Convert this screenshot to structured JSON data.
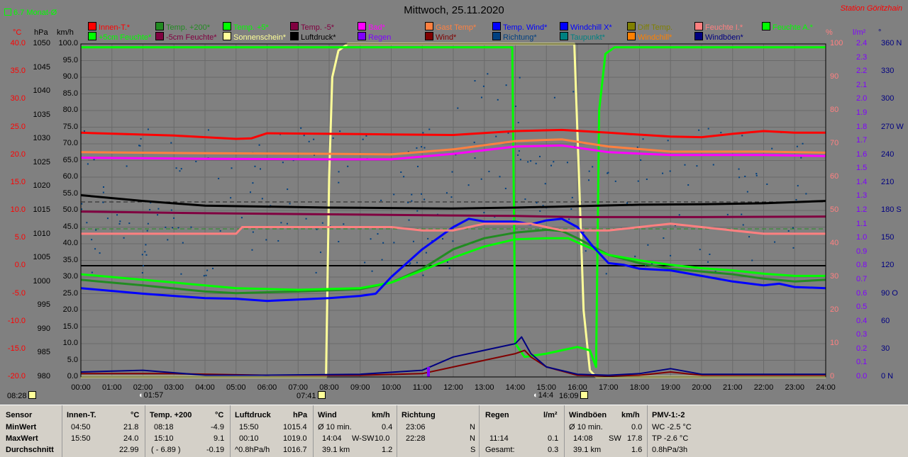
{
  "header": {
    "monat_label": "6.7 Monat-Ø",
    "title": "Mittwoch, 25.11.2020",
    "station": "Station Göritzhain"
  },
  "legend_row1": [
    {
      "label": "Innen-T.*",
      "color": "#ff0000"
    },
    {
      "label": "Temp. +200*",
      "color": "#228b22"
    },
    {
      "label": "Temp. +5*",
      "color": "#00ff00"
    },
    {
      "label": "Temp. -5*",
      "color": "#800040"
    },
    {
      "label": "Bad*",
      "color": "#ff00ff"
    },
    {
      "label": "Gast Temp*",
      "color": "#ff8040"
    },
    {
      "label": "Temp. Wind*",
      "color": "#0000ff"
    },
    {
      "label": "Windchill X*",
      "color": "#0000ff"
    },
    {
      "label": "Diff Temp.",
      "color": "#808000"
    },
    {
      "label": "Feuchte I.*",
      "color": "#ff8080"
    },
    {
      "label": "Feuchte A.*",
      "color": "#00ff00"
    }
  ],
  "legend_row2": [
    {
      "label": "+5cm Feuchte*",
      "color": "#00ff00"
    },
    {
      "label": "-5cm Feuchte*",
      "color": "#800040"
    },
    {
      "label": "Sonnenschein*",
      "color": "#ffff99"
    },
    {
      "label": "Luftdruck*",
      "color": "#000000"
    },
    {
      "label": "Regen",
      "color": "#8000ff"
    },
    {
      "label": "Wind*",
      "color": "#800000"
    },
    {
      "label": "Richtung*",
      "color": "#004080"
    },
    {
      "label": "Taupunkt*",
      "color": "#008080"
    },
    {
      "label": "Windchill*",
      "color": "#ff8000"
    },
    {
      "label": "Windböen*",
      "color": "#000080"
    }
  ],
  "axes": {
    "temp_unit": "°C",
    "hpa_unit": "hPa",
    "kmh_unit": "km/h",
    "pct_unit": "%",
    "lm2_unit": "l/m²",
    "deg_unit": "°",
    "temp_ticks": [
      "40.0",
      "35.0",
      "30.0",
      "25.0",
      "20.0",
      "15.0",
      "10.0",
      "5.0",
      "0.0",
      "-5.0",
      "-10.0",
      "-15.0",
      "-20.0"
    ],
    "hpa_ticks": [
      "1050",
      "1045",
      "1040",
      "1035",
      "1030",
      "1025",
      "1020",
      "1015",
      "1010",
      "1005",
      "1000",
      "995",
      "990",
      "985",
      "980"
    ],
    "kmh_ticks": [
      "100.0",
      "95.0",
      "90.0",
      "85.0",
      "80.0",
      "75.0",
      "70.0",
      "65.0",
      "60.0",
      "55.0",
      "50.0",
      "45.0",
      "40.0",
      "35.0",
      "30.0",
      "25.0",
      "20.0",
      "15.0",
      "10.0",
      "5.0",
      "0.0"
    ],
    "pct_ticks": [
      "100",
      "90",
      "80",
      "70",
      "60",
      "50",
      "40",
      "30",
      "20",
      "10",
      "0"
    ],
    "lm2_ticks": [
      "2.4",
      "2.3",
      "2.2",
      "2.1",
      "2.0",
      "1.9",
      "1.8",
      "1.7",
      "1.6",
      "1.5",
      "1.4",
      "1.3",
      "1.2",
      "1.1",
      "1.0",
      "0.9",
      "0.8",
      "0.7",
      "0.6",
      "0.5",
      "0.4",
      "0.3",
      "0.2",
      "0.1",
      "0.0"
    ],
    "deg_ticks": [
      "360 N",
      "330",
      "300",
      "270 W",
      "240",
      "210",
      "180 S",
      "150",
      "120",
      "90 O",
      "60",
      "30",
      "0 N"
    ],
    "x_ticks": [
      "00:00",
      "01:00",
      "02:00",
      "03:00",
      "04:00",
      "05:00",
      "06:00",
      "07:00",
      "08:00",
      "09:00",
      "10:00",
      "11:00",
      "12:00",
      "13:00",
      "14:00",
      "15:00",
      "16:00",
      "17:00",
      "18:00",
      "19:00",
      "20:00",
      "21:00",
      "22:00",
      "23:00",
      "24:00"
    ]
  },
  "events": {
    "sunrise_prev": "08:28",
    "moon_set": "01:57",
    "sunrise": "07:41",
    "moon_rise": "14:4",
    "sunset": "16:09"
  },
  "chart_data": {
    "type": "line",
    "title": "Mittwoch, 25.11.2020",
    "x_unit": "hour",
    "x_range": [
      0,
      24
    ],
    "series": [
      {
        "name": "Sonnenschein*",
        "axis": "pct",
        "color": "#ffff99",
        "points": [
          [
            0,
            0
          ],
          [
            7.9,
            0
          ],
          [
            8.0,
            60
          ],
          [
            8.1,
            90
          ],
          [
            8.3,
            98
          ],
          [
            8.6,
            100
          ],
          [
            15.9,
            100
          ],
          [
            16.05,
            60
          ],
          [
            16.2,
            20
          ],
          [
            16.4,
            2
          ],
          [
            16.6,
            0
          ],
          [
            24,
            0
          ]
        ]
      },
      {
        "name": "Feuchte A.*",
        "axis": "pct",
        "color": "#00ff00",
        "points": [
          [
            0,
            99
          ],
          [
            13.9,
            99
          ],
          [
            14.0,
            10
          ],
          [
            14.3,
            6
          ],
          [
            15.0,
            7
          ],
          [
            15.5,
            8
          ],
          [
            16.0,
            9
          ],
          [
            16.4,
            8
          ],
          [
            16.6,
            3
          ],
          [
            16.7,
            80
          ],
          [
            16.9,
            97
          ],
          [
            17.2,
            99
          ],
          [
            24,
            99
          ]
        ]
      },
      {
        "name": "Innen-T.*",
        "axis": "temp",
        "color": "#ff0000",
        "points": [
          [
            0,
            24.0
          ],
          [
            3,
            23.5
          ],
          [
            5,
            22.9
          ],
          [
            5.5,
            23.0
          ],
          [
            6,
            23.9
          ],
          [
            8,
            23.8
          ],
          [
            10,
            23.7
          ],
          [
            12,
            23.6
          ],
          [
            14,
            24.3
          ],
          [
            15.5,
            24.5
          ],
          [
            17,
            24.0
          ],
          [
            19,
            23.3
          ],
          [
            20,
            23.2
          ],
          [
            21,
            23.8
          ],
          [
            22,
            24.3
          ],
          [
            23,
            24.0
          ],
          [
            24,
            24.0
          ]
        ]
      },
      {
        "name": "Luftdruck*",
        "axis": "hpa",
        "color": "#000000",
        "points": [
          [
            0,
            1018.2
          ],
          [
            2,
            1017.0
          ],
          [
            4,
            1016.0
          ],
          [
            6,
            1015.8
          ],
          [
            8,
            1015.6
          ],
          [
            10,
            1015.5
          ],
          [
            12,
            1015.4
          ],
          [
            14,
            1015.6
          ],
          [
            16,
            1015.9
          ],
          [
            18,
            1016.2
          ],
          [
            20,
            1016.3
          ],
          [
            22,
            1016.5
          ],
          [
            24,
            1017.0
          ]
        ]
      },
      {
        "name": "Temp. +200*",
        "axis": "temp",
        "color": "#228b22",
        "points": [
          [
            0,
            -2.5
          ],
          [
            2,
            -3.5
          ],
          [
            4,
            -4.6
          ],
          [
            5,
            -4.9
          ],
          [
            7,
            -4.6
          ],
          [
            9,
            -4.2
          ],
          [
            10,
            -3.0
          ],
          [
            11,
            -0.5
          ],
          [
            12,
            3.0
          ],
          [
            13,
            5.0
          ],
          [
            14,
            6.0
          ],
          [
            15,
            6.5
          ],
          [
            15.5,
            6.3
          ],
          [
            16,
            5.0
          ],
          [
            17,
            2.0
          ],
          [
            18,
            0.5
          ],
          [
            19,
            -0.5
          ],
          [
            20,
            -1.0
          ],
          [
            21,
            -1.5
          ],
          [
            22,
            -2.3
          ],
          [
            23,
            -2.8
          ],
          [
            24,
            -2.5
          ]
        ]
      },
      {
        "name": "Temp. +5*",
        "axis": "temp",
        "color": "#00ff00",
        "points": [
          [
            0,
            -1.5
          ],
          [
            3,
            -3.0
          ],
          [
            5,
            -4.0
          ],
          [
            7,
            -4.3
          ],
          [
            9,
            -4.0
          ],
          [
            10,
            -3.0
          ],
          [
            11,
            -0.8
          ],
          [
            12,
            1.5
          ],
          [
            13,
            3.5
          ],
          [
            14,
            4.8
          ],
          [
            15,
            5.0
          ],
          [
            15.7,
            5.0
          ],
          [
            16.3,
            3.5
          ],
          [
            17,
            2.0
          ],
          [
            18,
            1.0
          ],
          [
            19,
            0.2
          ],
          [
            20,
            -0.4
          ],
          [
            21,
            -0.8
          ],
          [
            22,
            -1.4
          ],
          [
            23,
            -1.8
          ],
          [
            24,
            -1.8
          ]
        ]
      },
      {
        "name": "Temp. Wind*",
        "axis": "temp",
        "color": "#0000ff",
        "points": [
          [
            0,
            -4.0
          ],
          [
            2,
            -5.0
          ],
          [
            4,
            -5.8
          ],
          [
            5,
            -5.9
          ],
          [
            6,
            -6.3
          ],
          [
            8,
            -5.8
          ],
          [
            9,
            -5.4
          ],
          [
            9.5,
            -5.0
          ],
          [
            10,
            -2.0
          ],
          [
            11,
            3.0
          ],
          [
            12,
            7.0
          ],
          [
            12.5,
            8.5
          ],
          [
            13,
            8.0
          ],
          [
            14,
            8.0
          ],
          [
            14.5,
            7.5
          ],
          [
            15,
            8.2
          ],
          [
            15.5,
            8.5
          ],
          [
            16,
            7.0
          ],
          [
            16.5,
            3.5
          ],
          [
            17,
            0.5
          ],
          [
            17.5,
            0.2
          ],
          [
            18,
            -0.5
          ],
          [
            19,
            -0.8
          ],
          [
            20,
            -1.8
          ],
          [
            21,
            -2.8
          ],
          [
            22,
            -3.5
          ],
          [
            22.5,
            -3.2
          ],
          [
            23,
            -3.8
          ],
          [
            24,
            -4.0
          ]
        ]
      },
      {
        "name": "Temp. -5*",
        "axis": "temp",
        "color": "#800040",
        "points": [
          [
            0,
            9.8
          ],
          [
            4,
            9.5
          ],
          [
            8,
            9.3
          ],
          [
            12,
            9.1
          ],
          [
            14,
            9.0
          ],
          [
            16,
            8.8
          ],
          [
            20,
            8.8
          ],
          [
            24,
            8.9
          ]
        ]
      },
      {
        "name": "Gast Temp*",
        "axis": "temp",
        "color": "#ff8040",
        "points": [
          [
            0,
            20.5
          ],
          [
            4,
            20.3
          ],
          [
            8,
            20.2
          ],
          [
            10,
            20.1
          ],
          [
            12,
            21.0
          ],
          [
            14,
            22.5
          ],
          [
            15.5,
            22.8
          ],
          [
            17,
            21.5
          ],
          [
            19,
            20.6
          ],
          [
            22,
            20.6
          ],
          [
            24,
            20.4
          ]
        ]
      },
      {
        "name": "Bad*",
        "axis": "temp",
        "color": "#ff00ff",
        "points": [
          [
            0,
            19.5
          ],
          [
            4,
            19.3
          ],
          [
            8,
            19.2
          ],
          [
            10,
            19.2
          ],
          [
            12,
            20.2
          ],
          [
            14,
            21.5
          ],
          [
            15.5,
            21.7
          ],
          [
            17,
            20.5
          ],
          [
            19,
            20.0
          ],
          [
            22,
            20.0
          ],
          [
            24,
            19.8
          ]
        ]
      },
      {
        "name": "Feuchte I.*",
        "axis": "pct",
        "color": "#ff8080",
        "points": [
          [
            0,
            43
          ],
          [
            5,
            43
          ],
          [
            5.2,
            45
          ],
          [
            10,
            45
          ],
          [
            11,
            44
          ],
          [
            12,
            44
          ],
          [
            13,
            46
          ],
          [
            14.5,
            46
          ],
          [
            15.5,
            44
          ],
          [
            17,
            44
          ],
          [
            18,
            45
          ],
          [
            19,
            46
          ],
          [
            20,
            45
          ],
          [
            21,
            44
          ],
          [
            22,
            43
          ],
          [
            24,
            43
          ]
        ]
      },
      {
        "name": "Wind*",
        "axis": "kmh",
        "color": "#800000",
        "points": [
          [
            0,
            1
          ],
          [
            3,
            1
          ],
          [
            6,
            0.5
          ],
          [
            9,
            0.5
          ],
          [
            11,
            1
          ],
          [
            12,
            3
          ],
          [
            13,
            5
          ],
          [
            14,
            7
          ],
          [
            14.3,
            8
          ],
          [
            14.5,
            6
          ],
          [
            15,
            3
          ],
          [
            16,
            0.5
          ],
          [
            17,
            0.3
          ],
          [
            18,
            0.5
          ],
          [
            19,
            1.5
          ],
          [
            20,
            0.5
          ],
          [
            24,
            0.5
          ]
        ]
      },
      {
        "name": "Windböen*",
        "axis": "kmh",
        "color": "#000080",
        "points": [
          [
            0,
            1.5
          ],
          [
            2,
            2
          ],
          [
            4,
            0.5
          ],
          [
            6,
            0.5
          ],
          [
            9,
            0.8
          ],
          [
            11,
            2
          ],
          [
            12,
            6
          ],
          [
            13,
            8
          ],
          [
            14,
            10
          ],
          [
            14.2,
            12
          ],
          [
            14.5,
            7
          ],
          [
            15,
            3
          ],
          [
            16,
            0.8
          ],
          [
            17,
            0.5
          ],
          [
            18,
            1
          ],
          [
            19,
            2.5
          ],
          [
            20,
            0.8
          ],
          [
            24,
            0.8
          ]
        ]
      }
    ]
  },
  "stats": {
    "headers": {
      "sensor": "Sensor",
      "innen": "Innen-T.",
      "innen_u": "°C",
      "temp200": "Temp. +200",
      "temp200_u": "°C",
      "luftdruck": "Luftdruck",
      "luftdruck_u": "hPa",
      "wind": "Wind",
      "wind_u": "km/h",
      "richtung": "Richtung",
      "regen": "Regen",
      "regen_u": "l/m²",
      "windboeen": "Windböen",
      "windboeen_u": "km/h",
      "pmv": "PMV-1:-2"
    },
    "rowlabels": {
      "min": "MinWert",
      "max": "MaxWert",
      "avg": "Durchschnitt"
    },
    "innen": {
      "min_t": "04:50",
      "min_v": "21.8",
      "max_t": "15:50",
      "max_v": "24.0",
      "avg_v": "22.99"
    },
    "temp200": {
      "min_t": "08:18",
      "min_v": "-4.9",
      "max_t": "15:10",
      "max_v": "9.1",
      "avg_t": "( - 6.89 )",
      "avg_v": "-0.19"
    },
    "luftdruck": {
      "min_t": "15:50",
      "min_v": "1015.4",
      "max_t": "00:10",
      "max_v": "1019.0",
      "avg_t": "^0.8hPa/h",
      "avg_v": "1016.7"
    },
    "wind": {
      "min_t": "Ø 10 min.",
      "min_v": "0.4",
      "max_t": "14:04",
      "max_d": "W-SW",
      "max_v": "10.0",
      "avg_t": "39.1 km",
      "avg_v": "1.2"
    },
    "richtung": {
      "min_t": "23:06",
      "min_v": "N",
      "max_t": "22:28",
      "max_v": "N",
      "avg_v": "S"
    },
    "regen": {
      "max_t": "11:14",
      "max_v": "0.1",
      "avg_t": "Gesamt:",
      "avg_v": "0.3"
    },
    "windboeen": {
      "min_t": "Ø 10 min.",
      "min_v": "0.0",
      "max_t": "14:08",
      "max_d": "SW",
      "max_v": "17.8",
      "avg_t": "39.1 km",
      "avg_v": "1.6"
    },
    "pmv": {
      "min": "WC -2.5 °C",
      "max": "TP -2.6 °C",
      "avg": "0.8hPa/3h"
    }
  }
}
